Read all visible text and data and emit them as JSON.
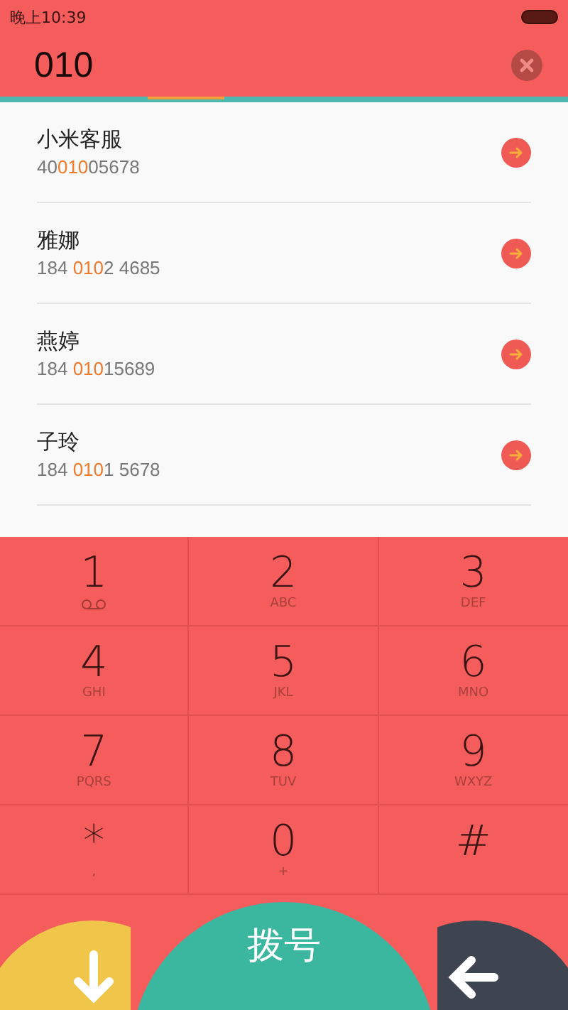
{
  "status_bar": {
    "time": "晚上10:39"
  },
  "search": {
    "value": "010"
  },
  "contacts": [
    {
      "name": "小米客服",
      "number": {
        "before": "40",
        "match": "010",
        "after": "05678"
      }
    },
    {
      "name": "雅娜",
      "number": {
        "before": "184 ",
        "match": "010",
        "after": "2 4685"
      }
    },
    {
      "name": "燕婷",
      "number": {
        "before": "184 ",
        "match": "010",
        "after": "15689"
      }
    },
    {
      "name": "子玲",
      "number": {
        "before": "184 ",
        "match": "010",
        "after": "1 5678"
      }
    }
  ],
  "keys": [
    {
      "kind": "voicemail",
      "digit": "1"
    },
    {
      "kind": "letters",
      "digit": "2",
      "letters": "ABC"
    },
    {
      "kind": "letters",
      "digit": "3",
      "letters": "DEF"
    },
    {
      "kind": "letters",
      "digit": "4",
      "letters": "GHI"
    },
    {
      "kind": "letters",
      "digit": "5",
      "letters": "JKL"
    },
    {
      "kind": "letters",
      "digit": "6",
      "letters": "MNO"
    },
    {
      "kind": "letters",
      "digit": "7",
      "letters": "PQRS"
    },
    {
      "kind": "letters",
      "digit": "8",
      "letters": "TUV"
    },
    {
      "kind": "letters",
      "digit": "9",
      "letters": "WXYZ"
    },
    {
      "kind": "letters",
      "digit": "*",
      "letters": ","
    },
    {
      "kind": "letters",
      "digit": "0",
      "letters": "+"
    },
    {
      "kind": "plain",
      "digit": "#"
    }
  ],
  "dial_button": {
    "label": "拨号"
  }
}
